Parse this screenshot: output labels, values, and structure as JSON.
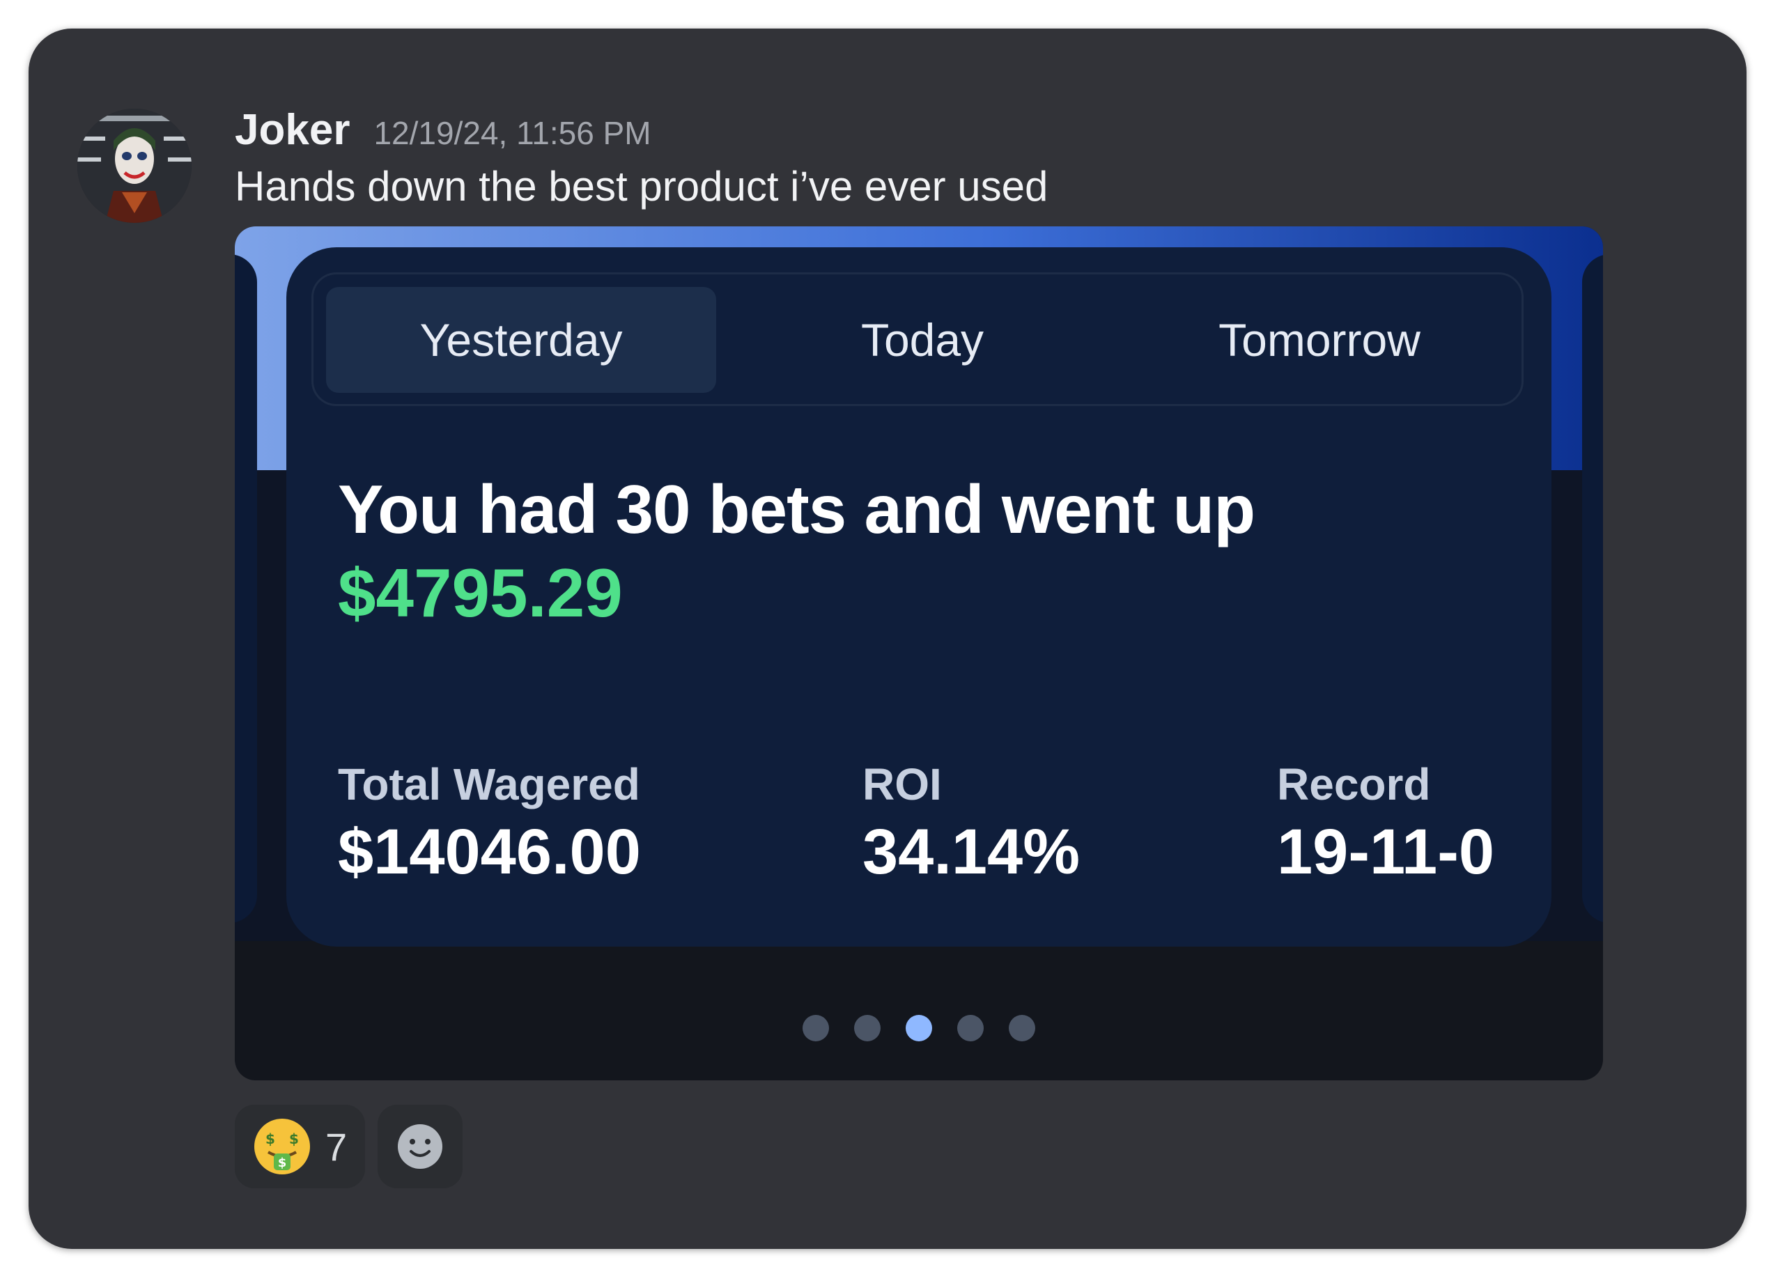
{
  "message": {
    "username": "Joker",
    "timestamp": "12/19/24, 11:56 PM",
    "text": "Hands down the best product i’ve ever used"
  },
  "embed": {
    "tabs": [
      {
        "label": "Yesterday",
        "selected": true
      },
      {
        "label": "Today",
        "selected": false
      },
      {
        "label": "Tomorrow",
        "selected": false
      }
    ],
    "headline": "You had 30 bets and went up",
    "amount": "$4795.29",
    "stats": [
      {
        "label": "Total Wagered",
        "value": "$14046.00"
      },
      {
        "label": "ROI",
        "value": "34.14%"
      },
      {
        "label": "Record",
        "value": "19-11-0"
      }
    ],
    "pagination": {
      "count": 5,
      "active_index": 2
    },
    "colors": {
      "accent_green": "#4fe08a",
      "card_bg": "#0f1e3b",
      "active_dot": "#8fb8ff"
    }
  },
  "reactions": [
    {
      "icon": "money-mouth-face-icon",
      "count": "7"
    },
    {
      "icon": "add-reaction-icon",
      "count": ""
    }
  ]
}
